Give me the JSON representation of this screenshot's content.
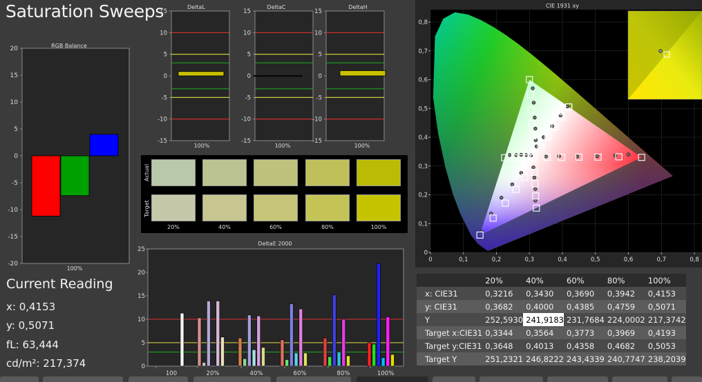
{
  "title": "Saturation Sweeps",
  "rgb_balance": {
    "title": "RGB Balance",
    "yticks": [
      "20",
      "15",
      "10",
      "5",
      "0",
      "-5",
      "-10",
      "-15",
      "-20"
    ],
    "xlabel": "100%",
    "bars": [
      {
        "name": "red",
        "value": -11.2,
        "color": "#ff0000"
      },
      {
        "name": "green",
        "value": -7.4,
        "color": "#00a000"
      },
      {
        "name": "blue",
        "value": 4.0,
        "color": "#0000ff"
      }
    ]
  },
  "delta_charts": [
    {
      "title": "DeltaL",
      "value": 1.0,
      "xlabel": "100%"
    },
    {
      "title": "DeltaC",
      "value": 0.1,
      "xlabel": "100%"
    },
    {
      "title": "DeltaH",
      "value": 1.2,
      "xlabel": "100%"
    }
  ],
  "delta_yticks": [
    "15",
    "10",
    "5",
    "0",
    "-5",
    "-10",
    "-15"
  ],
  "swatches": {
    "row_labels": [
      "Actual",
      "Target"
    ],
    "col_labels": [
      "20%",
      "40%",
      "60%",
      "80%",
      "100%"
    ],
    "actual_colors": [
      "#b9c8aa",
      "#bbc490",
      "#bec27a",
      "#bfc05a",
      "#bbbb06"
    ],
    "target_colors": [
      "#c6c8aa",
      "#c7c690",
      "#c6c476",
      "#c4c456",
      "#c6c400"
    ]
  },
  "current_reading": {
    "title": "Current Reading",
    "x": "x: 0,4153",
    "y": "y: 0,5071",
    "fl": "fL: 63,444",
    "cdm2": "cd/m²: 217,374"
  },
  "cie": {
    "title": "CIE 1931 xy",
    "xticks": [
      "0",
      "0,1",
      "0,2",
      "0,3",
      "0,4",
      "0,5",
      "0,6",
      "0,7",
      "0,8"
    ],
    "yticks": [
      "0,8",
      "0,7",
      "0,6",
      "0,5",
      "0,4",
      "0,3",
      "0,2",
      "0,1",
      "0"
    ]
  },
  "table": {
    "headers": [
      "",
      "20%",
      "40%",
      "60%",
      "80%",
      "100%"
    ],
    "rows": [
      {
        "label": "x: CIE31",
        "values": [
          "0,3216",
          "0,3430",
          "0,3690",
          "0,3942",
          "0,4153"
        ]
      },
      {
        "label": "y: CIE31",
        "values": [
          "0,3682",
          "0,4000",
          "0,4385",
          "0,4759",
          "0,5071"
        ]
      },
      {
        "label": "Y",
        "values": [
          "252,5930",
          "241,9183",
          "231,7684",
          "224,0002",
          "217,3742"
        ]
      },
      {
        "label": "Target x:CIE31",
        "values": [
          "0,3344",
          "0,3564",
          "0,3773",
          "0,3969",
          "0,4193"
        ]
      },
      {
        "label": "Target y:CIE31",
        "values": [
          "0,3648",
          "0,4013",
          "0,4358",
          "0,4682",
          "0,5053"
        ]
      },
      {
        "label": "Target Y",
        "values": [
          "251,2321",
          "246,8222",
          "243,4339",
          "240,7747",
          "238,2039"
        ]
      }
    ]
  },
  "chart_data": [
    {
      "type": "bar",
      "title": "RGB Balance",
      "categories": [
        "100%"
      ],
      "series": [
        {
          "name": "red",
          "values": [
            -11.2
          ]
        },
        {
          "name": "green",
          "values": [
            -7.4
          ]
        },
        {
          "name": "blue",
          "values": [
            4.0
          ]
        }
      ],
      "ylim": [
        -20,
        20
      ]
    },
    {
      "type": "bar",
      "title": "DeltaE 2000",
      "categories": [
        "100",
        "20%",
        "40%",
        "60%",
        "80%",
        "100%"
      ],
      "series": [
        {
          "name": "white",
          "values": [
            11.3,
            0,
            0,
            0,
            0,
            0
          ]
        },
        {
          "name": "red",
          "values": [
            0,
            10.3,
            6.0,
            5.6,
            6.0,
            5.0
          ]
        },
        {
          "name": "green",
          "values": [
            0,
            0.8,
            1.6,
            1.4,
            2.0,
            4.7
          ]
        },
        {
          "name": "blue",
          "values": [
            0,
            13.9,
            10.9,
            13.3,
            15.2,
            21.9
          ]
        },
        {
          "name": "cyan",
          "values": [
            0,
            0,
            3.5,
            2.8,
            3.0,
            1.8
          ]
        },
        {
          "name": "magenta",
          "values": [
            0,
            13.9,
            10.7,
            12.2,
            10.0,
            10.5
          ]
        },
        {
          "name": "yellow",
          "values": [
            0,
            6.2,
            4.0,
            2.8,
            2.2,
            2.5
          ]
        }
      ],
      "ylim": [
        0,
        25
      ],
      "yticks": [
        "25",
        "20",
        "15",
        "10",
        "5",
        "0"
      ]
    },
    {
      "type": "bar",
      "title": "DeltaL",
      "categories": [
        "100%"
      ],
      "values": [
        1.0
      ],
      "ylim": [
        -15,
        15
      ]
    },
    {
      "type": "bar",
      "title": "DeltaC",
      "categories": [
        "100%"
      ],
      "values": [
        0.1
      ],
      "ylim": [
        -15,
        15
      ]
    },
    {
      "type": "bar",
      "title": "DeltaH",
      "categories": [
        "100%"
      ],
      "values": [
        1.2
      ],
      "ylim": [
        -15,
        15
      ]
    },
    {
      "type": "scatter",
      "title": "CIE 1931 xy",
      "xlim": [
        0,
        0.8
      ],
      "ylim": [
        0,
        0.85
      ],
      "series": [
        {
          "name": "targets",
          "points": [
            [
              0.64,
              0.33
            ],
            [
              0.571,
              0.332
            ],
            [
              0.508,
              0.331
            ],
            [
              0.45,
              0.331
            ],
            [
              0.398,
              0.33
            ],
            [
              0.354,
              0.33
            ],
            [
              0.3,
              0.6
            ],
            [
              0.303,
              0.548
            ],
            [
              0.305,
              0.494
            ],
            [
              0.308,
              0.448
            ],
            [
              0.31,
              0.405
            ],
            [
              0.15,
              0.06
            ],
            [
              0.19,
              0.119
            ],
            [
              0.227,
              0.171
            ],
            [
              0.259,
              0.219
            ],
            [
              0.286,
              0.261
            ],
            [
              0.225,
              0.329
            ],
            [
              0.255,
              0.329
            ],
            [
              0.276,
              0.329
            ],
            [
              0.293,
              0.329
            ],
            [
              0.305,
              0.329
            ],
            [
              0.321,
              0.154
            ],
            [
              0.319,
              0.196
            ],
            [
              0.317,
              0.238
            ],
            [
              0.315,
              0.278
            ],
            [
              0.419,
              0.505
            ],
            [
              0.393,
              0.474
            ],
            [
              0.368,
              0.437
            ],
            [
              0.345,
              0.402
            ],
            [
              0.3344,
              0.3648
            ],
            [
              0.3564,
              0.4013
            ],
            [
              0.3773,
              0.4358
            ],
            [
              0.3969,
              0.4682
            ],
            [
              0.4193,
              0.5053
            ],
            [
              0.3127,
              0.329
            ]
          ]
        },
        {
          "name": "measured",
          "points": [
            [
              0.6,
              0.34
            ],
            [
              0.56,
              0.336
            ],
            [
              0.505,
              0.334
            ],
            [
              0.445,
              0.333
            ],
            [
              0.39,
              0.334
            ],
            [
              0.35,
              0.333
            ],
            [
              0.31,
              0.57
            ],
            [
              0.313,
              0.52
            ],
            [
              0.316,
              0.468
            ],
            [
              0.318,
              0.43
            ],
            [
              0.319,
              0.39
            ],
            [
              0.155,
              0.072
            ],
            [
              0.184,
              0.135
            ],
            [
              0.215,
              0.19
            ],
            [
              0.248,
              0.236
            ],
            [
              0.275,
              0.276
            ],
            [
              0.24,
              0.338
            ],
            [
              0.26,
              0.338
            ],
            [
              0.275,
              0.339
            ],
            [
              0.29,
              0.338
            ],
            [
              0.305,
              0.337
            ],
            [
              0.318,
              0.18
            ],
            [
              0.318,
              0.22
            ],
            [
              0.315,
              0.26
            ],
            [
              0.312,
              0.295
            ],
            [
              0.4153,
              0.5071
            ],
            [
              0.3942,
              0.4759
            ],
            [
              0.369,
              0.4385
            ],
            [
              0.343,
              0.4
            ],
            [
              0.3216,
              0.3682
            ]
          ]
        }
      ]
    }
  ]
}
